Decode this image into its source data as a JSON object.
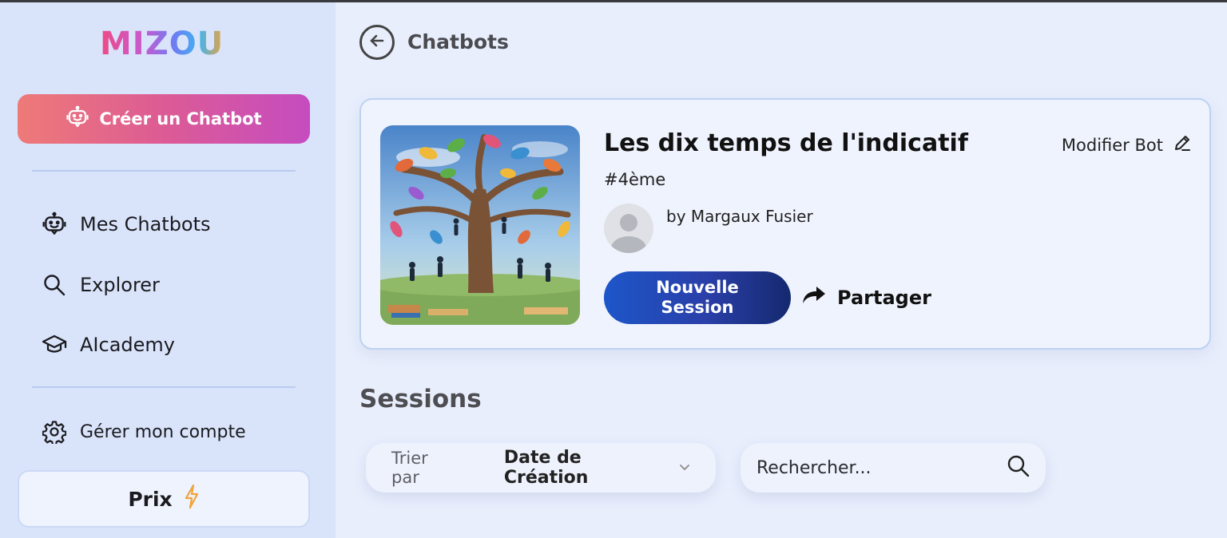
{
  "sidebar": {
    "logo": "MIZOU",
    "create_button": "Créer un Chatbot",
    "nav": [
      {
        "label": "Mes Chatbots",
        "icon": "robot-icon"
      },
      {
        "label": "Explorer",
        "icon": "search-icon"
      },
      {
        "label": "AIcademy",
        "icon": "graduation-cap-icon"
      }
    ],
    "account": {
      "label": "Gérer mon compte",
      "icon": "gear-icon"
    },
    "pricing": {
      "label": "Prix",
      "icon": "lightning-icon"
    }
  },
  "header": {
    "title": "Chatbots"
  },
  "bot": {
    "title": "Les dix temps de l'indicatif",
    "grade": "#4ème",
    "author": "by Margaux Fusier",
    "modify_label": "Modifier Bot",
    "new_session_label": "Nouvelle\nSession",
    "share_label": "Partager"
  },
  "sessions": {
    "title": "Sessions",
    "sort_label": "Trier par",
    "sort_value": "Date de Création",
    "search_placeholder": "Rechercher..."
  },
  "colors": {
    "background": "#e8eefc",
    "sidebar": "#d9e4fb",
    "create_gradient_start": "#ee7a78",
    "create_gradient_end": "#c54cc0",
    "primary_button": "#1d56c9",
    "lightning": "#f2a33a"
  }
}
